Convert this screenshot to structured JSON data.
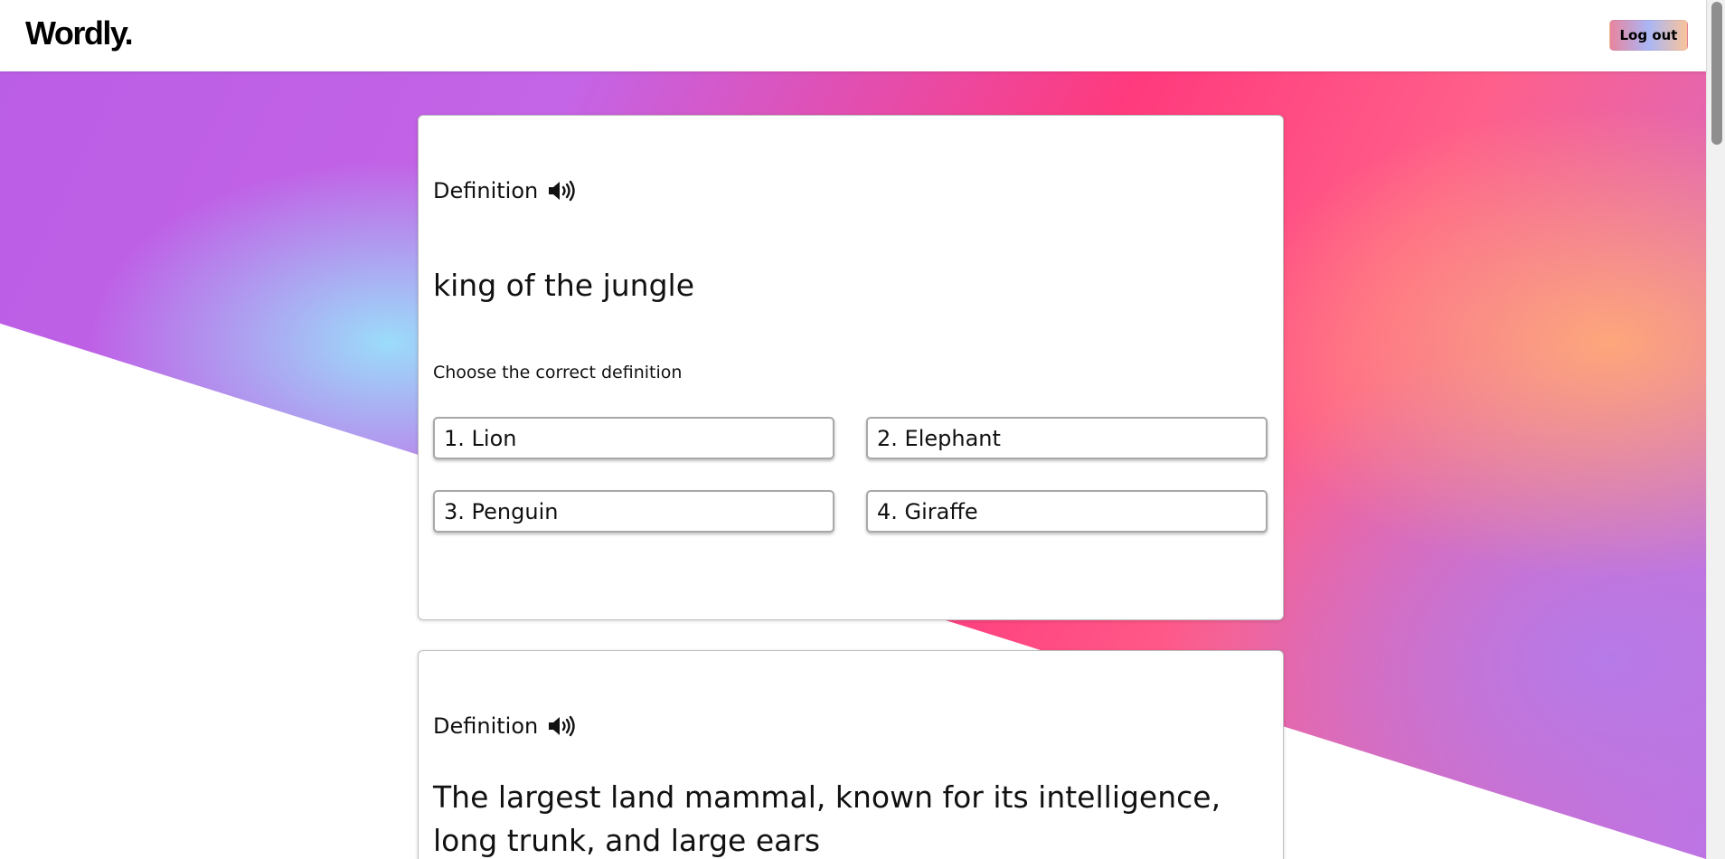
{
  "header": {
    "logo": "Wordly.",
    "logout_label": "Log out"
  },
  "cards": [
    {
      "label": "Definition",
      "speaker_icon": "speaker-volume-icon",
      "prompt": "king of the jungle",
      "instruction": "Choose the correct definition",
      "options": [
        "1. Lion",
        "2. Elephant",
        "3. Penguin",
        "4. Giraffe"
      ]
    },
    {
      "label": "Definition",
      "speaker_icon": "speaker-volume-icon",
      "prompt": "The largest land mammal, known for its intelligence, long trunk, and large ears"
    }
  ],
  "colors": {
    "accent_pink": "#ff3a7d",
    "accent_purple": "#bb5ee6",
    "accent_blue": "#9bdcfa",
    "accent_orange": "#ffaa78"
  }
}
